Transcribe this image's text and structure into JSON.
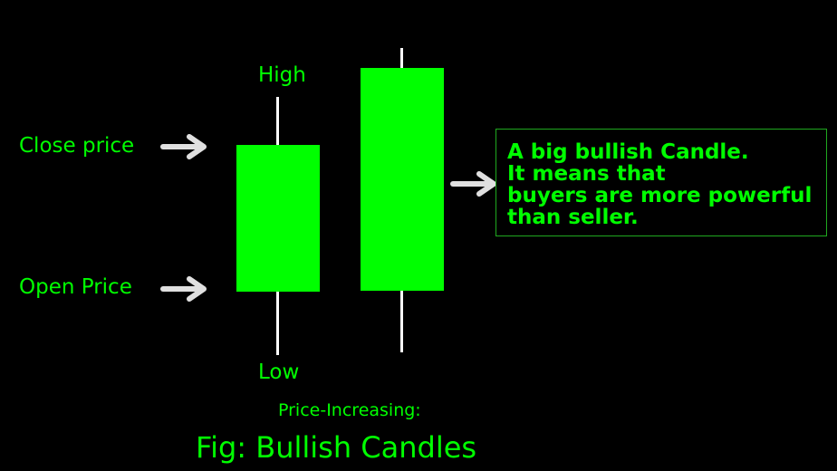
{
  "labels": {
    "close_price": "Close price",
    "open_price": "Open Price",
    "high": "High",
    "low": "Low",
    "subtitle": "Price-Increasing:",
    "figure_caption": "Fig: Bullish Candles"
  },
  "note": {
    "lines": [
      "A big bullish Candle.",
      "It means that",
      "buyers are more powerful",
      "than seller."
    ]
  },
  "colors": {
    "background": "#000000",
    "text": "#00ff00",
    "candle_body": "#00ff00",
    "wick": "#ffffff",
    "arrow": "#e0e0e0",
    "note_border": "#1fa81f"
  },
  "icons": {
    "pointer_arrow": "right-arrow-icon"
  }
}
